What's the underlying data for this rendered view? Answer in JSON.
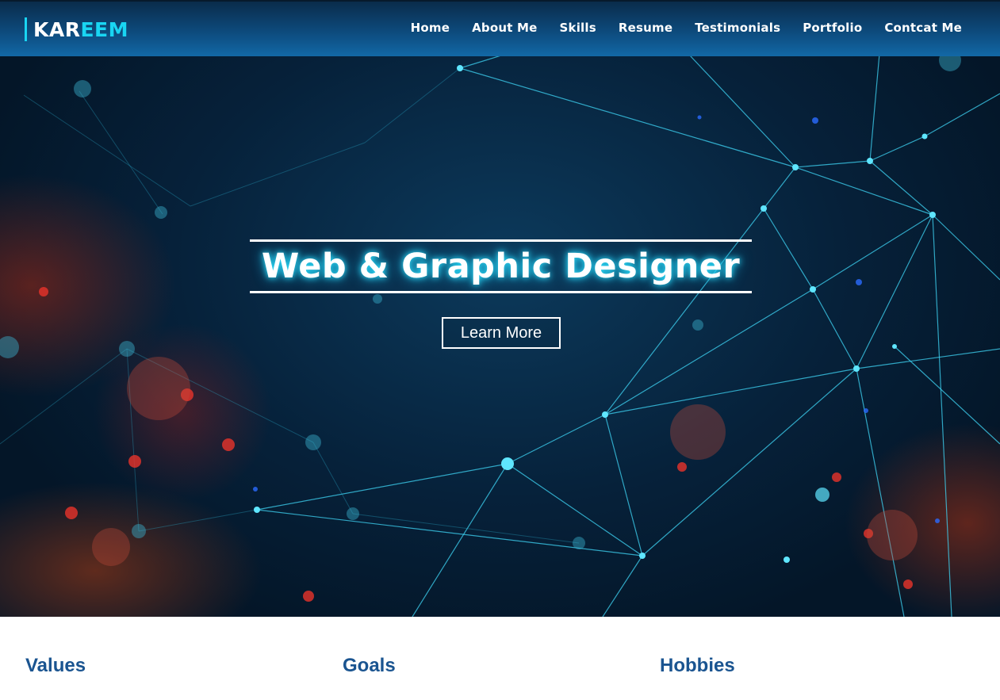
{
  "brand": {
    "logo_part1": "KAR",
    "logo_part2": "EEM"
  },
  "nav": {
    "items": [
      {
        "label": "Home"
      },
      {
        "label": "About Me"
      },
      {
        "label": "Skills"
      },
      {
        "label": "Resume"
      },
      {
        "label": "Testimonials"
      },
      {
        "label": "Portfolio"
      },
      {
        "label": "Contcat Me"
      }
    ]
  },
  "hero": {
    "headline": "Web & Graphic Designer",
    "cta_label": "Learn More"
  },
  "sections": [
    {
      "title": "Values"
    },
    {
      "title": "Goals"
    },
    {
      "title": "Hobbies"
    }
  ],
  "colors": {
    "accent": "#19d5f3",
    "header": "#0d4a7c",
    "section_title": "#1a5490"
  }
}
